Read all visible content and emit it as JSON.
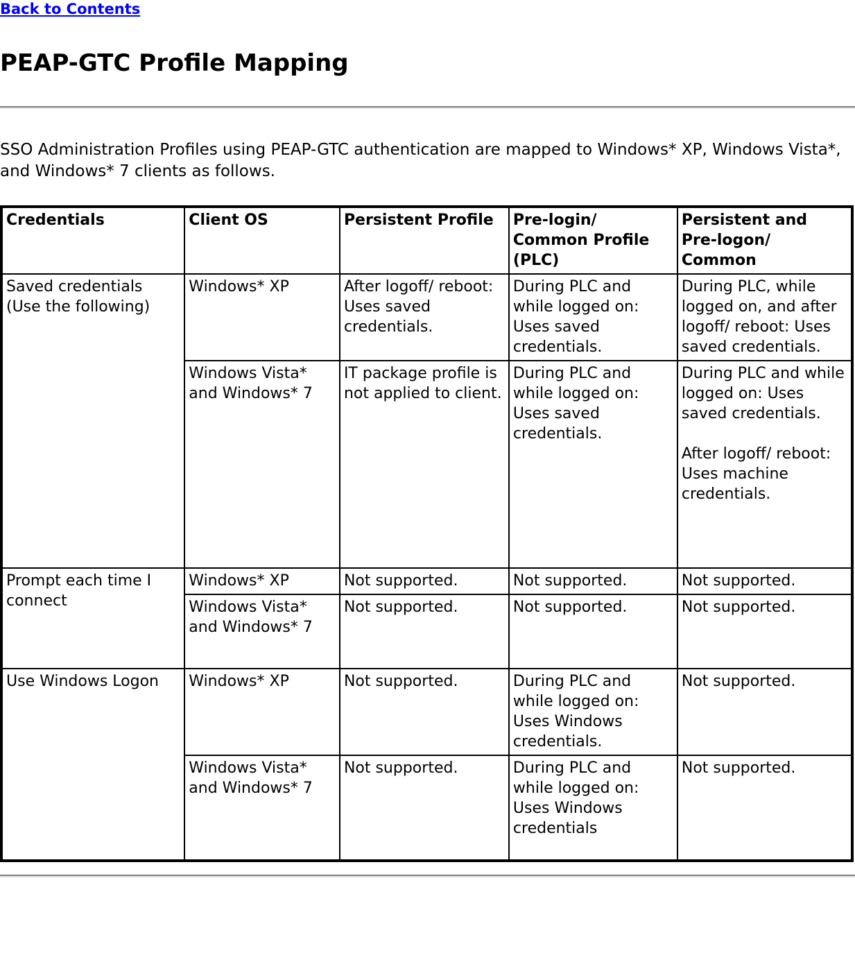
{
  "nav": {
    "back_link": "Back to Contents"
  },
  "header": {
    "title": "PEAP-GTC Profile Mapping"
  },
  "intro": {
    "paragraph": "SSO Administration Profiles using PEAP-GTC authentication are mapped to Windows* XP, Windows Vista*, and Windows* 7 clients as follows."
  },
  "table": {
    "columns": [
      "Credentials",
      "Client OS",
      "Persistent Profile",
      "Pre-login/ Common Profile (PLC)",
      "Persistent and Pre-logon/ Common"
    ],
    "rows": [
      {
        "credentials": "Saved credentials (Use the following)",
        "subrows": [
          {
            "client_os": "Windows* XP",
            "persistent_profile": "After logoff/ reboot: Uses saved credentials.",
            "plc": "During PLC and while logged on: Uses saved credentials.",
            "persistent_prelogon": "During PLC, while logged on, and after logoff/ reboot: Uses saved credentials.",
            "persistent_prelogon_2": ""
          },
          {
            "client_os": "Windows Vista* and Windows* 7",
            "persistent_profile": "IT package profile is not applied to client.",
            "plc": "During PLC and while logged on: Uses saved credentials.",
            "persistent_prelogon": "During PLC and while logged on: Uses saved credentials.",
            "persistent_prelogon_2": "After logoff/ reboot: Uses machine credentials."
          }
        ]
      },
      {
        "credentials": "Prompt each time I connect",
        "subrows": [
          {
            "client_os": "Windows* XP",
            "persistent_profile": "Not supported.",
            "plc": "Not supported.",
            "persistent_prelogon": "Not supported.",
            "persistent_prelogon_2": ""
          },
          {
            "client_os": "Windows Vista* and Windows* 7",
            "persistent_profile": "Not supported.",
            "plc": "Not supported.",
            "persistent_prelogon": "Not supported.",
            "persistent_prelogon_2": ""
          }
        ]
      },
      {
        "credentials": "Use Windows Logon",
        "subrows": [
          {
            "client_os": "Windows* XP",
            "persistent_profile": "Not supported.",
            "plc": "During PLC and while logged on: Uses Windows credentials.",
            "persistent_prelogon": "Not supported.",
            "persistent_prelogon_2": ""
          },
          {
            "client_os": "Windows Vista* and Windows* 7",
            "persistent_profile": "Not supported.",
            "plc": "During PLC and while logged on: Uses Windows credentials",
            "persistent_prelogon": "Not supported.",
            "persistent_prelogon_2": ""
          }
        ]
      }
    ]
  },
  "colors": {
    "link": "#0000FF",
    "text": "#000000",
    "rule_dark": "#808080",
    "rule_light": "#E0E0E0",
    "border": "#000000",
    "background": "#FFFFFF"
  }
}
